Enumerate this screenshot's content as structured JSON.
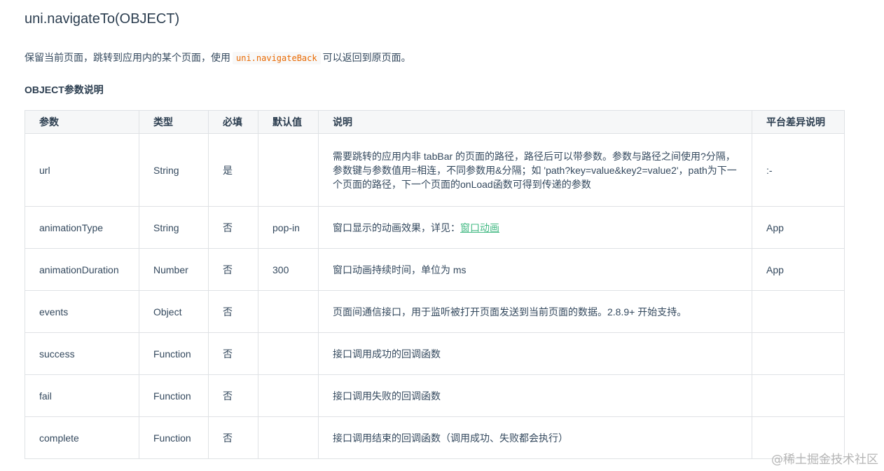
{
  "title": "uni.navigateTo(OBJECT)",
  "intro": {
    "before": "保留当前页面，跳转到应用内的某个页面，使用",
    "code": "uni.navigateBack",
    "after": "可以返回到原页面。"
  },
  "subheading": "OBJECT参数说明",
  "table": {
    "headers": [
      "参数",
      "类型",
      "必填",
      "默认值",
      "说明",
      "平台差异说明"
    ],
    "rows": [
      {
        "name": "url",
        "type": "String",
        "required": "是",
        "default": "",
        "desc": "需要跳转的应用内非 tabBar 的页面的路径，路径后可以带参数。参数与路径之间使用?分隔，参数键与参数值用=相连，不同参数用&分隔；如 'path?key=value&key2=value2'，path为下一个页面的路径，下一个页面的onLoad函数可得到传递的参数",
        "platform": ":-"
      },
      {
        "name": "animationType",
        "type": "String",
        "required": "否",
        "default": "pop-in",
        "desc": "窗口显示的动画效果，详见：",
        "desc_link": "窗口动画",
        "platform": "App"
      },
      {
        "name": "animationDuration",
        "type": "Number",
        "required": "否",
        "default": "300",
        "desc": "窗口动画持续时间，单位为 ms",
        "platform": "App"
      },
      {
        "name": "events",
        "type": "Object",
        "required": "否",
        "default": "",
        "desc": "页面间通信接口，用于监听被打开页面发送到当前页面的数据。2.8.9+ 开始支持。",
        "platform": ""
      },
      {
        "name": "success",
        "type": "Function",
        "required": "否",
        "default": "",
        "desc": "接口调用成功的回调函数",
        "platform": ""
      },
      {
        "name": "fail",
        "type": "Function",
        "required": "否",
        "default": "",
        "desc": "接口调用失败的回调函数",
        "platform": ""
      },
      {
        "name": "complete",
        "type": "Function",
        "required": "否",
        "default": "",
        "desc": "接口调用结束的回调函数（调用成功、失败都会执行）",
        "platform": ""
      }
    ]
  },
  "watermark": "@稀土掘金技术社区",
  "colors": {
    "link": "#42b983",
    "code": "#e96900",
    "header_bg": "#f6f7f8",
    "border": "#dfe2e5"
  }
}
